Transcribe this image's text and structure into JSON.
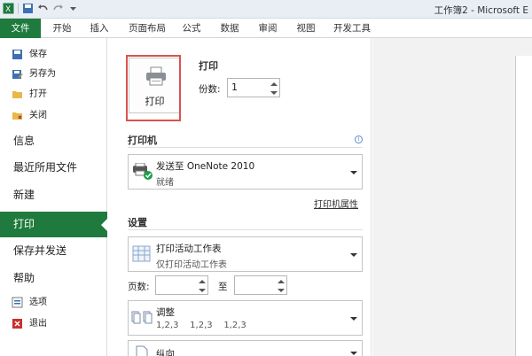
{
  "titlebar": {
    "title": "工作簿2 - Microsoft E",
    "qat": [
      "save-icon",
      "undo-icon",
      "redo-icon",
      "customize-icon"
    ]
  },
  "ribbon": {
    "file_tab": "文件",
    "tabs": [
      "开始",
      "插入",
      "页面布局",
      "公式",
      "数据",
      "审阅",
      "视图",
      "开发工具"
    ]
  },
  "nav": {
    "save": "保存",
    "save_as": "另存为",
    "open": "打开",
    "close": "关闭",
    "info": "信息",
    "recent": "最近所用文件",
    "new": "新建",
    "print": "打印",
    "save_send": "保存并发送",
    "help": "帮助",
    "options": "选项",
    "exit": "退出"
  },
  "print": {
    "section_title": "打印",
    "button_label": "打印",
    "copies_label": "份数:",
    "copies_value": "1"
  },
  "printer": {
    "section_title": "打印机",
    "name": "发送至 OneNote 2010",
    "status": "就绪",
    "properties_link": "打印机属性"
  },
  "settings": {
    "section_title": "设置",
    "scope_title": "打印活动工作表",
    "scope_desc": "仅打印活动工作表",
    "pages_label": "页数:",
    "to_label": "至",
    "pages_from": "",
    "pages_to": "",
    "collate_title": "调整",
    "collate_desc": "1,2,3    1,2,3    1,2,3",
    "orientation_title": "纵向"
  },
  "colors": {
    "accent": "#1f7a3d",
    "highlight": "#d9534f"
  }
}
